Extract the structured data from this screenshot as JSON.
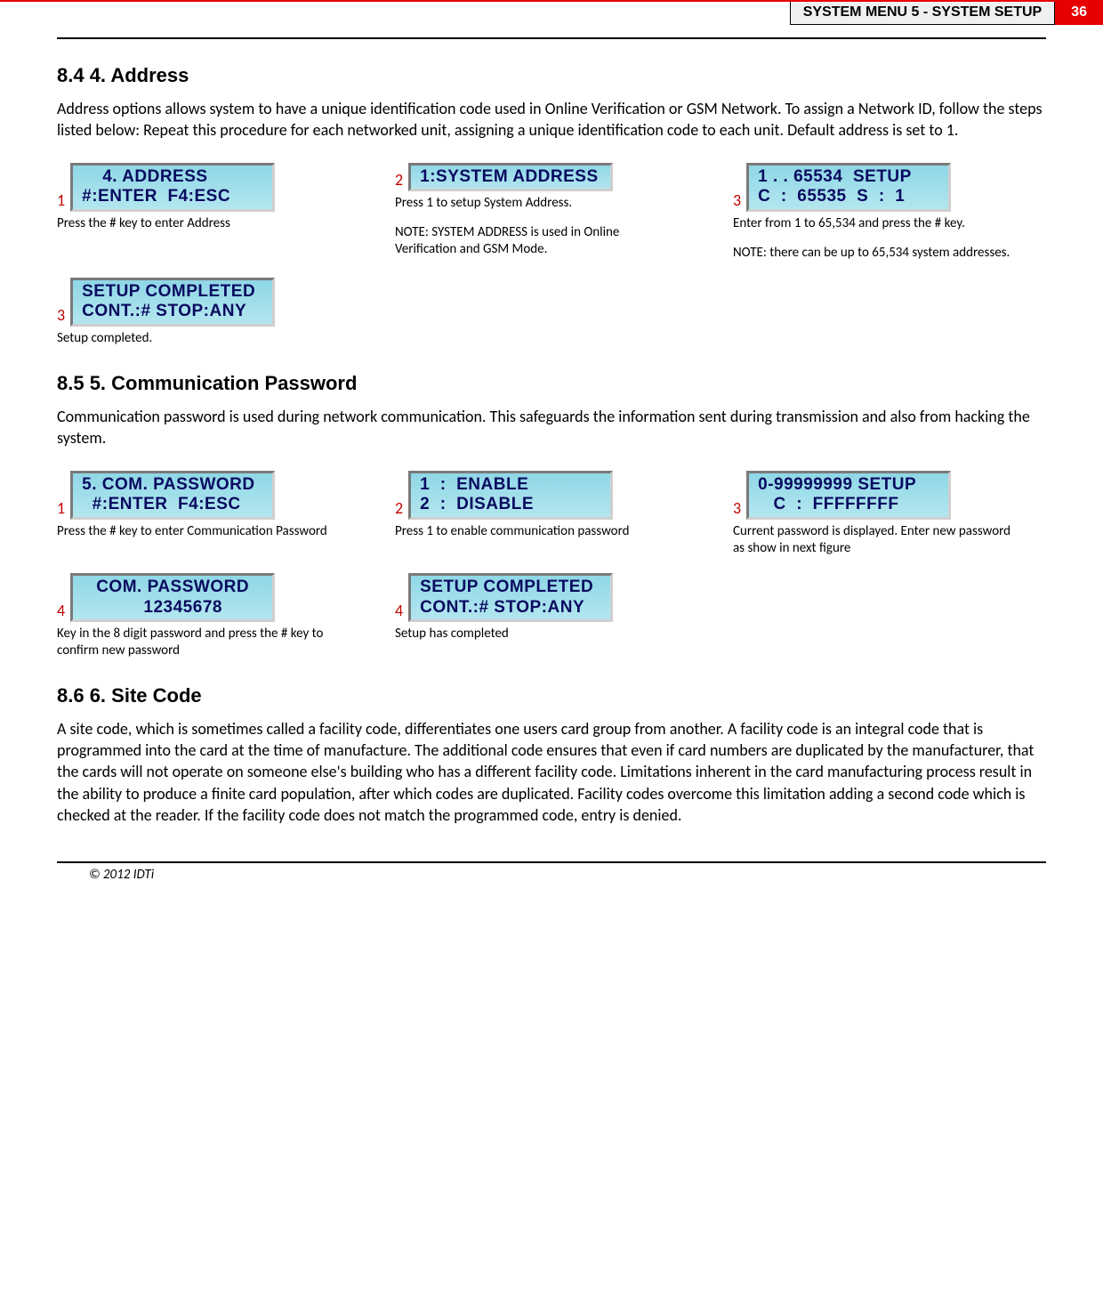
{
  "header": {
    "section_label": "SYSTEM MENU 5 - SYSTEM SETUP",
    "page_number": "36"
  },
  "section84": {
    "heading": "8.4    4. Address",
    "intro": "Address options allows system to have a unique identification code used in Online Verification or GSM Network. To assign a Network ID, follow the steps listed below: Repeat this procedure for each networked unit, assigning a unique identification code to each unit. Default address is set to 1.",
    "steps": [
      {
        "num": "1",
        "lcd": "    4. ADDRESS\n#:ENTER  F4:ESC",
        "caption": "Press the # key to enter Address",
        "note": ""
      },
      {
        "num": "2",
        "lcd": "1:SYSTEM ADDRESS",
        "caption": "Press 1 to setup System Address.",
        "note": "NOTE: SYSTEM ADDRESS is used in Online Verification and GSM Mode."
      },
      {
        "num": "3",
        "lcd": "1 . . 65534  SETUP\nC  :  65535  S  :  1",
        "caption": "Enter from 1 to 65,534 and press the # key.",
        "note": "NOTE: there can be up to 65,534 system addresses."
      },
      {
        "num": "3",
        "lcd": "SETUP COMPLETED\nCONT.:# STOP:ANY",
        "caption": "Setup completed.",
        "note": ""
      }
    ]
  },
  "section85": {
    "heading": "8.5    5. Communication Password",
    "intro": "Communication password is used during network communication. This safeguards the information sent during transmission and also from hacking the system.",
    "steps": [
      {
        "num": "1",
        "lcd": "5. COM. PASSWORD\n  #:ENTER  F4:ESC",
        "caption": "Press the # key to enter Communication Password"
      },
      {
        "num": "2",
        "lcd": "1  :  ENABLE\n2  :  DISABLE",
        "caption": "Press 1 to enable communication password"
      },
      {
        "num": "3",
        "lcd": "0-99999999 SETUP\n   C  :  FFFFFFFF",
        "caption": "Current password is displayed. Enter new password as show in next figure"
      },
      {
        "num": "4",
        "lcd": "COM. PASSWORD\n    12345678",
        "caption": "Key in the 8 digit password and press the # key to confirm new password"
      },
      {
        "num": "4",
        "lcd": "SETUP COMPLETED\nCONT.:# STOP:ANY",
        "caption": "Setup has completed"
      }
    ]
  },
  "section86": {
    "heading": "8.6    6. Site Code",
    "intro": "A  site code, which is sometimes called a facility code, differentiates one users card group from another. A facility code is an integral code that is programmed into the card at the time of manufacture. The additional code ensures that even if card numbers are duplicated by the manufacturer, that the cards will not operate on someone else's building who has a different facility code. Limitations inherent in the card manufacturing process result in the ability to produce a finite card population, after which codes are duplicated. Facility codes overcome this limitation adding a second code which is checked at the reader. If the facility code does not match the programmed code, entry is denied."
  },
  "footer": {
    "copyright": "© 2012 IDTi"
  }
}
